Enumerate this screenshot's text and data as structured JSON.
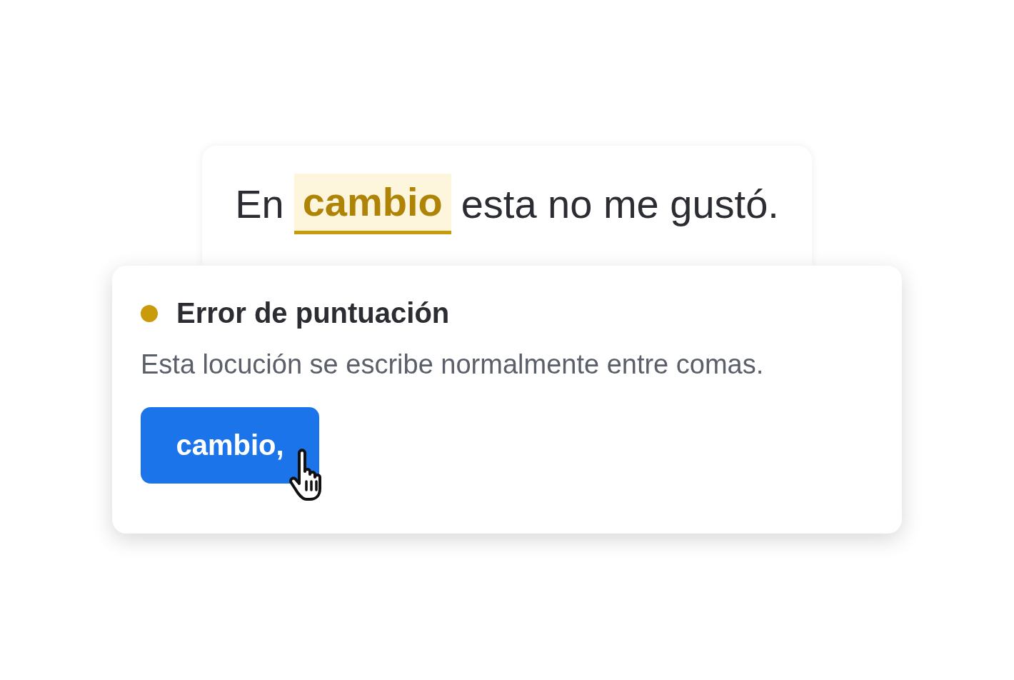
{
  "editor": {
    "sentence_before": "En",
    "highlight": "cambio",
    "sentence_after": "esta no me gustó."
  },
  "suggestion": {
    "status": {
      "color": "#c99a0a"
    },
    "title": "Error de puntuación",
    "description": "Esta locución se escribe normalmente entre comas.",
    "button": "cambio,"
  }
}
